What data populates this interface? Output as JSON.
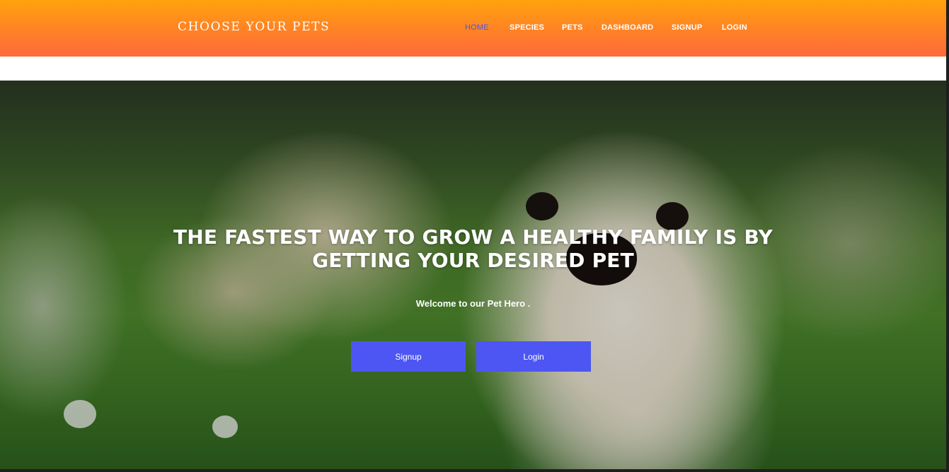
{
  "header": {
    "brand": "CHOOSE YOUR PETS",
    "nav": [
      {
        "label": "HOME",
        "active": true
      },
      {
        "label": "SPECIES",
        "active": false
      },
      {
        "label": "PETS",
        "active": false
      },
      {
        "label": "DASHBOARD",
        "active": false
      },
      {
        "label": "SIGNUP",
        "active": false
      },
      {
        "label": "LOGIN",
        "active": false
      }
    ],
    "gradient_top": "#ffa30d",
    "gradient_bottom": "#ff6a3b",
    "active_color": "#4d56e6"
  },
  "hero": {
    "headline_line1": "THE FASTEST WAY TO GROW A HEALTHY FAMILY IS BY",
    "headline_line2": "GETTING YOUR DESIRED PET",
    "welcome": "Welcome to our Pet Hero .",
    "signup_button": "Signup",
    "login_button": "Login",
    "button_color": "#4d56f2",
    "background_image": "puppy-on-grass-photo"
  }
}
